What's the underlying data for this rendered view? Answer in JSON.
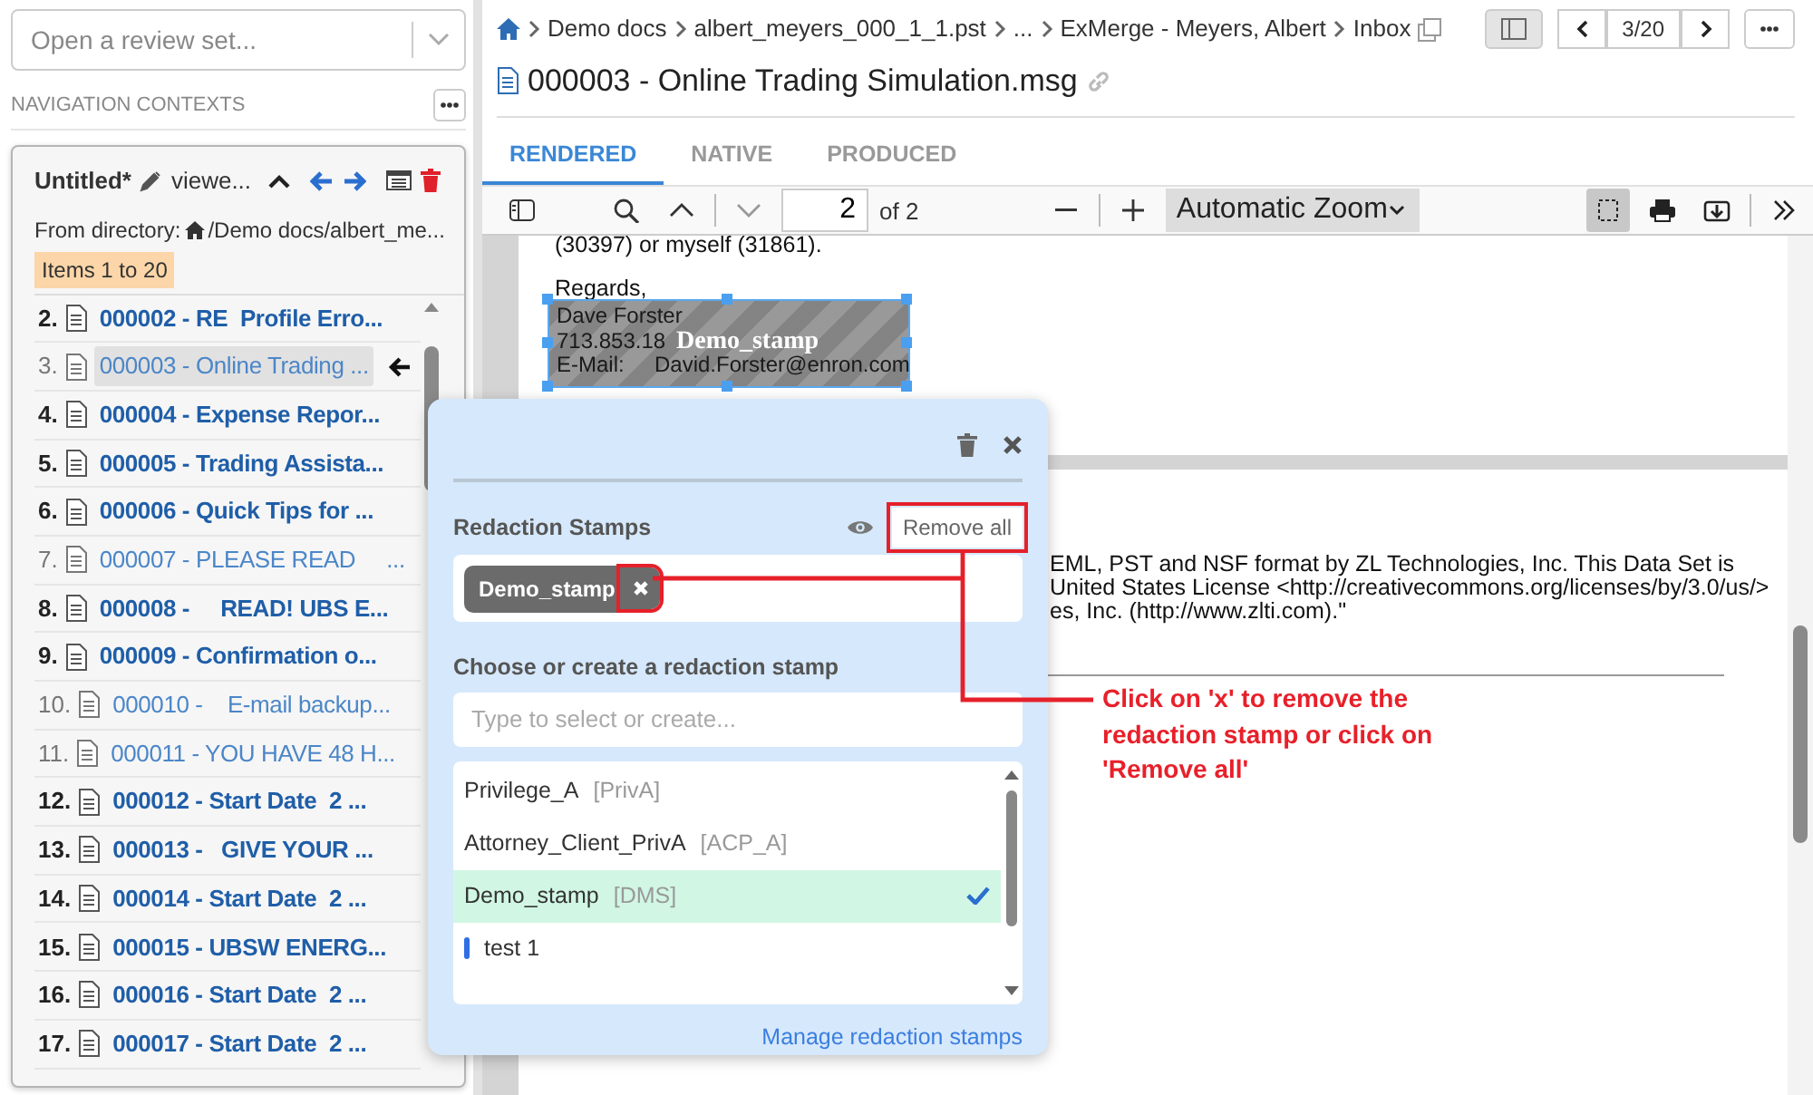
{
  "review_set_select": {
    "placeholder": "Open a review set..."
  },
  "navigation_contexts": {
    "heading": "NAVIGATION CONTEXTS",
    "context": {
      "name": "Untitled*",
      "view": "viewe...",
      "from_label": "From directory:",
      "path": "/Demo docs/albert_me...",
      "items_badge": "Items 1 to 20",
      "items": [
        {
          "number": "2.",
          "title": "000002 - RE  Profile Erro...",
          "unread": true,
          "selected": false
        },
        {
          "number": "3.",
          "title": "000003 - Online Trading ...",
          "unread": false,
          "selected": true
        },
        {
          "number": "4.",
          "title": "000004 - Expense Repor...",
          "unread": true,
          "selected": false
        },
        {
          "number": "5.",
          "title": "000005 - Trading Assista...",
          "unread": true,
          "selected": false
        },
        {
          "number": "6.",
          "title": "000006 - Quick Tips for ...",
          "unread": true,
          "selected": false
        },
        {
          "number": "7.",
          "title": "000007 - PLEASE READ     ...",
          "unread": false,
          "selected": false
        },
        {
          "number": "8.",
          "title": "000008 -     READ! UBS E...",
          "unread": true,
          "selected": false
        },
        {
          "number": "9.",
          "title": "000009 - Confirmation o...",
          "unread": true,
          "selected": false
        },
        {
          "number": "10.",
          "title": "000010 -    E-mail backup...",
          "unread": false,
          "selected": false
        },
        {
          "number": "11.",
          "title": "000011 - YOU HAVE 48 H...",
          "unread": false,
          "selected": false
        },
        {
          "number": "12.",
          "title": "000012 - Start Date  2 ...",
          "unread": true,
          "selected": false
        },
        {
          "number": "13.",
          "title": "000013 -   GIVE YOUR ...",
          "unread": true,
          "selected": false
        },
        {
          "number": "14.",
          "title": "000014 - Start Date  2 ...",
          "unread": true,
          "selected": false
        },
        {
          "number": "15.",
          "title": "000015 - UBSW ENERG...",
          "unread": true,
          "selected": false
        },
        {
          "number": "16.",
          "title": "000016 - Start Date  2 ...",
          "unread": true,
          "selected": false
        },
        {
          "number": "17.",
          "title": "000017 - Start Date  2 ...",
          "unread": true,
          "selected": false
        }
      ]
    }
  },
  "document": {
    "breadcrumb": [
      "Demo docs",
      "albert_meyers_000_1_1.pst",
      "...",
      "ExMerge - Meyers, Albert",
      "Inbox"
    ],
    "pager": "3/20",
    "title": "000003 - Online Trading Simulation.msg",
    "tabs": [
      {
        "label": "RENDERED",
        "selected": true
      },
      {
        "label": "NATIVE",
        "selected": false
      },
      {
        "label": "PRODUCED",
        "selected": false
      }
    ],
    "viewer": {
      "page": "2",
      "page_count": "of 2",
      "zoom": "Automatic Zoom",
      "page1_lines": [
        "(30397) or myself (31861).",
        "Regards,"
      ],
      "stamp": {
        "label": "Demo_stamp",
        "lines": [
          "Dave Forster",
          "713.853.18",
          "E-Mail:     David.Forster@enron.com"
        ]
      },
      "page2_lines": [
        "EML, PST and NSF format by ZL Technologies, Inc. This Data Set is",
        "United States License <http://creativecommons.org/licenses/by/3.0/us/>",
        "es, Inc. (http://www.zlti.com).\""
      ]
    }
  },
  "redaction_popover": {
    "stamps_heading": "Redaction Stamps",
    "remove_all": "Remove all",
    "applied": [
      {
        "label": "Demo_stamp"
      }
    ],
    "choose_label": "Choose or create a redaction stamp",
    "search": {
      "placeholder": "Type to select or create..."
    },
    "options": [
      {
        "kind": "stamp",
        "name": "Privilege_A",
        "code": "[PrivA]",
        "selected": false
      },
      {
        "kind": "stamp",
        "name": "Attorney_Client_PrivA",
        "code": "[ACP_A]",
        "selected": false
      },
      {
        "kind": "stamp",
        "name": "Demo_stamp",
        "code": "[DMS]",
        "selected": true
      },
      {
        "kind": "marked",
        "name": "test 1",
        "selected": false
      }
    ],
    "manage_link": "Manage redaction stamps"
  },
  "annotation": {
    "text": "Click on 'x' to remove the redaction stamp or click on 'Remove all'"
  }
}
